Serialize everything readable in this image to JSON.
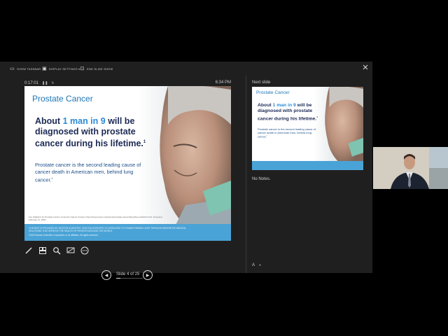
{
  "toolbar": {
    "show_taskbar": "SHOW TASKBAR",
    "display_settings": "DISPLAY SETTINGS ▾",
    "end_slide_show": "END SLIDE SHOW"
  },
  "presenter": {
    "elapsed_time": "0:17:01",
    "clock": "6:34 PM",
    "slide_count": "Slide 4 of 25",
    "progress_fraction": 0.16
  },
  "current_slide": {
    "title": "Prostate Cancer",
    "headline_pre": "About ",
    "headline_highlight": "1 man in 9",
    "headline_post": " will be diagnosed with prostate cancer during his lifetime.",
    "headline_sup": "1",
    "subtext": "Prostate cancer is the second leading cause of cancer death in American men, behind lung cancer.",
    "subtext_sup": "1",
    "footnote": "Key Statistics for Prostate Cancer. American Cancer Society. https://www.cancer.org/cancer/prostate-cancer/about/key-statistics.html. Accessed February 11, 2020.",
    "footer_line1": "CONTENT IS PROVIDED BY BOSTON SCIENTIFIC. BOSTON SCIENTIFIC IS DEDICATED TO TRANSFORMING LIVES THROUGH INNOVATIVE MEDICAL SOLUTIONS THAT IMPROVE THE HEALTH OF PATIENTS AROUND THE WORLD.",
    "footer_line2": "©2020 Boston Scientific Corporation or its affiliates. All rights reserved."
  },
  "next_slide": {
    "label": "Next slide",
    "title": "Prostate Cancer",
    "headline_pre": "About ",
    "headline_highlight": "1 man in 9",
    "headline_post": " will be diagnosed with prostate cancer during his lifetime.",
    "headline_sup": "1",
    "subtext": "Prostate cancer is the second leading cause of cancer death in American men, behind lung cancer.",
    "subtext_sup": "1"
  },
  "notes": {
    "text": "No Notes.",
    "font_increase": "A",
    "font_decrease": "A"
  },
  "icons": {
    "pen": "pen-icon",
    "slides": "see-all-slides-icon",
    "zoom": "zoom-icon",
    "screen": "black-screen-icon",
    "more": "more-options-icon",
    "prev": "previous-icon",
    "next": "next-icon"
  },
  "colors": {
    "window_bg": "#1f1f1f",
    "title_blue": "#1e76b8",
    "headline_navy": "#1c2a55",
    "highlight_blue": "#2a8ad6",
    "footer_band": "#4aa3d6"
  }
}
